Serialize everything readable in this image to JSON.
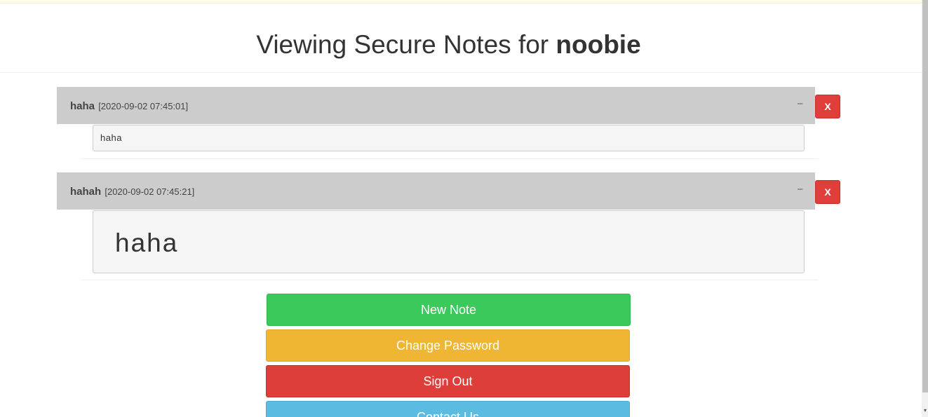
{
  "header": {
    "title_prefix": "Viewing Secure Notes for ",
    "username": "noobie"
  },
  "notes": [
    {
      "title": "haha",
      "timestamp": "[2020-09-02 07:45:01]",
      "collapse_label": "−",
      "delete_label": "X",
      "content": "haha"
    },
    {
      "title": "hahah",
      "timestamp": "[2020-09-02 07:45:21]",
      "collapse_label": "−",
      "delete_label": "X",
      "content": "haha"
    }
  ],
  "actions": {
    "new_note": "New Note",
    "change_password": "Change Password",
    "sign_out": "Sign Out",
    "contact_us": "Contact Us"
  },
  "scrollbar": {
    "down_arrow": "▾"
  },
  "colors": {
    "note_header": "#cccccc",
    "delete": "#df3e3a",
    "new_note": "#3cc95c",
    "change_password": "#efb633",
    "sign_out": "#de3e39",
    "contact_us": "#5cbbe1"
  }
}
